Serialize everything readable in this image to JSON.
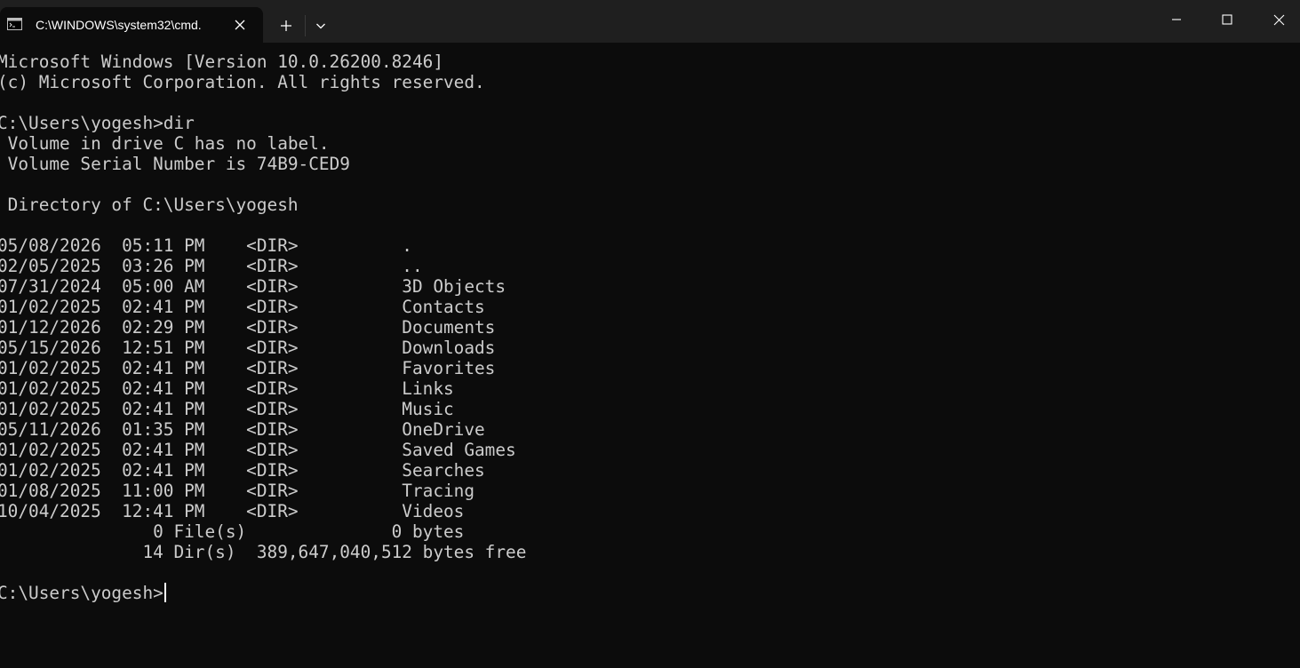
{
  "window": {
    "tab_title": "C:\\WINDOWS\\system32\\cmd.",
    "tab_icon": "cmd-terminal-icon",
    "close_tab_icon": "close-icon",
    "new_tab_icon": "plus-icon",
    "dropdown_icon": "chevron-down-icon",
    "minimize_icon": "minimize-icon",
    "maximize_icon": "maximize-icon",
    "close_window_icon": "close-icon"
  },
  "colors": {
    "background": "#0c0c0c",
    "titlebar": "#1f1f1f",
    "text": "#cccccc"
  },
  "console": {
    "lines": [
      "Microsoft Windows [Version 10.0.26200.8246]",
      "(c) Microsoft Corporation. All rights reserved.",
      "",
      "C:\\Users\\yogesh>dir",
      " Volume in drive C has no label.",
      " Volume Serial Number is 74B9-CED9",
      "",
      " Directory of C:\\Users\\yogesh",
      "",
      "05/08/2026  05:11 PM    <DIR>          .",
      "02/05/2025  03:26 PM    <DIR>          ..",
      "07/31/2024  05:00 AM    <DIR>          3D Objects",
      "01/02/2025  02:41 PM    <DIR>          Contacts",
      "01/12/2026  02:29 PM    <DIR>          Documents",
      "05/15/2026  12:51 PM    <DIR>          Downloads",
      "01/02/2025  02:41 PM    <DIR>          Favorites",
      "01/02/2025  02:41 PM    <DIR>          Links",
      "01/02/2025  02:41 PM    <DIR>          Music",
      "05/11/2026  01:35 PM    <DIR>          OneDrive",
      "01/02/2025  02:41 PM    <DIR>          Saved Games",
      "01/02/2025  02:41 PM    <DIR>          Searches",
      "01/08/2025  11:00 PM    <DIR>          Tracing",
      "10/04/2025  12:41 PM    <DIR>          Videos",
      "               0 File(s)              0 bytes",
      "              14 Dir(s)  389,647,040,512 bytes free",
      ""
    ],
    "prompt": "C:\\Users\\yogesh>"
  }
}
